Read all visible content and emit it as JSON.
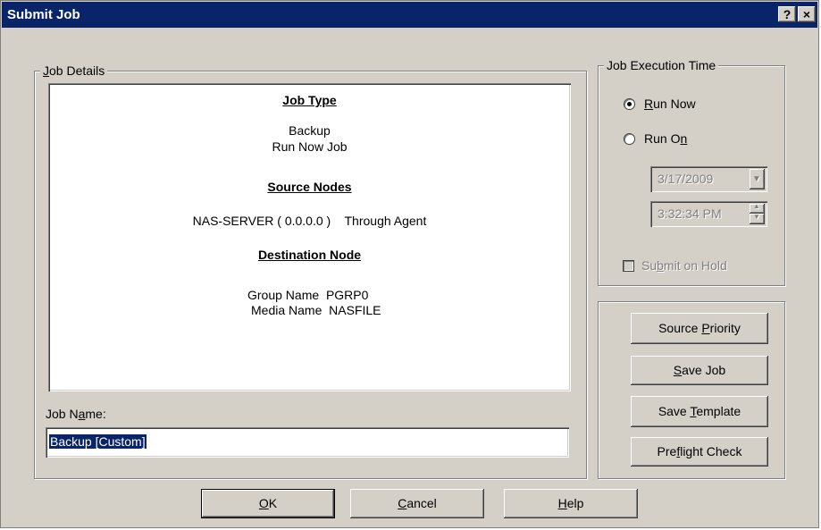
{
  "window": {
    "title": "Submit Job",
    "help_button": "?",
    "close_button": "×"
  },
  "job_details": {
    "legend": "Job Details",
    "job_type_header": "Job Type",
    "job_type_line1": "Backup",
    "job_type_line2": "Run Now Job",
    "source_header": "Source Nodes",
    "source_line": "NAS-SERVER ( 0.0.0.0 )    Through Agent",
    "destination_header": "Destination Node",
    "group_label": "Group Name",
    "group_value": "PGRP0",
    "media_label": "Media Name",
    "media_value": "NASFILE",
    "job_name_label": "Job Name:",
    "job_name_value": "Backup [Custom]"
  },
  "execution": {
    "legend": "Job Execution Time",
    "run_now": "Run Now",
    "run_on": "Run On",
    "date_value": "3/17/2009",
    "time_value": "3:32:34 PM",
    "submit_on_hold": "Submit on Hold",
    "selected": "run_now"
  },
  "side_buttons": {
    "source_priority": "Source Priority",
    "save_job": "Save Job",
    "save_template": "Save Template",
    "preflight_check": "Preflight Check"
  },
  "bottom_buttons": {
    "ok": "OK",
    "cancel": "Cancel",
    "help": "Help"
  }
}
